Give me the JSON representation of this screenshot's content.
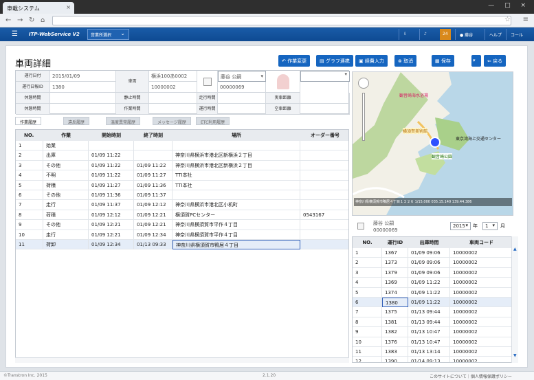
{
  "browser": {
    "tab_title": "車載システム"
  },
  "app": {
    "logo": "ITP-WebService V2",
    "office_select": "営業所選択",
    "header_buttons": [
      "ヘルプ",
      "コール"
    ],
    "user": "藤谷",
    "badge": "24"
  },
  "page": {
    "title": "車両詳細",
    "actions": [
      "作業変更",
      "グラフ連携",
      "経費入力",
      "取消",
      "保存",
      "戻る"
    ]
  },
  "form": {
    "labels": [
      "運行日付",
      "運行日報ID",
      "休憩時間",
      "休憩時間",
      "車両",
      "静止時間",
      "作業時間",
      "走行時間",
      "運行時間",
      "実車距離",
      "空車距離"
    ],
    "date": "2015/01/09",
    "report_id": "1380",
    "vehicle_name": "横浜100あ0002",
    "vehicle_code": "10000002",
    "driver_name": "藤谷 公嗣",
    "driver_code": "00000069"
  },
  "subtabs": [
    "作業履歴",
    "違反履歴",
    "温度異常履歴",
    "メッセージ履歴",
    "ETC利用履歴"
  ],
  "table": {
    "headers": [
      "NO.",
      "作業",
      "開始時刻",
      "終了時刻",
      "場所",
      "オーダー番号"
    ],
    "rows": [
      [
        "1",
        "始業",
        "",
        "",
        "",
        ""
      ],
      [
        "2",
        "出庫",
        "01/09 11:22",
        "",
        "神奈川県横浜市港北区新横浜２丁目",
        ""
      ],
      [
        "3",
        "その他",
        "01/09 11:22",
        "01/09 11:22",
        "神奈川県横浜市港北区新横浜２丁目",
        ""
      ],
      [
        "4",
        "不明",
        "01/09 11:22",
        "01/09 11:27",
        "TTI本社",
        ""
      ],
      [
        "5",
        "荷積",
        "01/09 11:27",
        "01/09 11:36",
        "TTI本社",
        ""
      ],
      [
        "6",
        "その他",
        "01/09 11:36",
        "01/09 11:37",
        "",
        ""
      ],
      [
        "7",
        "走行",
        "01/09 11:37",
        "01/09 12:12",
        "神奈川県横浜市港北区小机町",
        ""
      ],
      [
        "8",
        "荷積",
        "01/09 12:12",
        "01/09 12:21",
        "横須賀PCセンター",
        "0543167"
      ],
      [
        "9",
        "その他",
        "01/09 12:21",
        "01/09 12:21",
        "神奈川県横須賀市平作４丁目",
        ""
      ],
      [
        "10",
        "走行",
        "01/09 12:21",
        "01/09 12:34",
        "神奈川県横須賀市平作４丁目",
        ""
      ],
      [
        "11",
        "荷卸",
        "01/09 12:34",
        "01/13 09:33",
        "神奈川県横須賀市鴨居４丁目",
        ""
      ]
    ]
  },
  "map": {
    "caption": "神奈川県横須賀市鴨居４丁目１２２６ 1/15,000 035.15.140 139.44.386",
    "labels": [
      "観音崎海水浴場",
      "横須賀美術館",
      "東京湾海上交通センター",
      "観音崎公園"
    ]
  },
  "vehicle_box": {
    "name": "藤谷 公嗣",
    "code": "00000069",
    "year": "2015",
    "month": "1",
    "year_label": "年",
    "month_label": "月"
  },
  "right_table": {
    "headers": [
      "NO.",
      "運行ID",
      "出庫時間",
      "車両コード"
    ],
    "rows": [
      [
        "1",
        "1367",
        "01/09 09:06",
        "10000002"
      ],
      [
        "2",
        "1373",
        "01/09 09:06",
        "10000002"
      ],
      [
        "3",
        "1379",
        "01/09 09:06",
        "10000002"
      ],
      [
        "4",
        "1369",
        "01/09 11:22",
        "10000002"
      ],
      [
        "5",
        "1374",
        "01/09 11:22",
        "10000002"
      ],
      [
        "6",
        "1380",
        "01/09 11:22",
        "10000002"
      ],
      [
        "7",
        "1375",
        "01/13 09:44",
        "10000002"
      ],
      [
        "8",
        "1381",
        "01/13 09:44",
        "10000002"
      ],
      [
        "9",
        "1382",
        "01/13 10:47",
        "10000002"
      ],
      [
        "10",
        "1376",
        "01/13 10:47",
        "10000002"
      ],
      [
        "11",
        "1383",
        "01/13 13:14",
        "10000002"
      ],
      [
        "12",
        "1390",
        "01/14 09:13",
        "10000002"
      ]
    ]
  },
  "footer": {
    "left": "©Transtron Inc. 2015",
    "version": "2.1.20",
    "right": "このサイトについて｜個人情報保護ポリシー"
  }
}
